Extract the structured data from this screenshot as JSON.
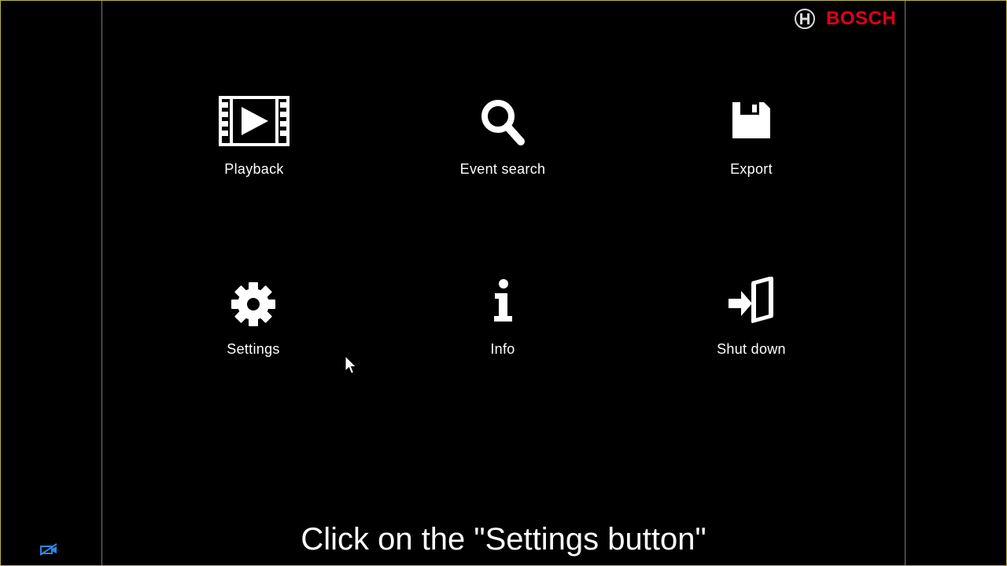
{
  "brand": {
    "name": "BOSCH",
    "color": "#e20015",
    "icon": "bosch-armature-icon"
  },
  "menu": [
    {
      "id": "playback",
      "label": "Playback",
      "icon": "film-play-icon"
    },
    {
      "id": "event-search",
      "label": "Event search",
      "icon": "search-icon"
    },
    {
      "id": "export",
      "label": "Export",
      "icon": "floppy-disk-icon"
    },
    {
      "id": "settings",
      "label": "Settings",
      "icon": "gear-icon"
    },
    {
      "id": "info",
      "label": "Info",
      "icon": "info-icon"
    },
    {
      "id": "shutdown",
      "label": "Shut down",
      "icon": "exit-door-icon"
    }
  ],
  "caption": "Click on the \"Settings button\"",
  "status": {
    "icon": "network-disconnected-icon",
    "color": "#2e86de"
  }
}
